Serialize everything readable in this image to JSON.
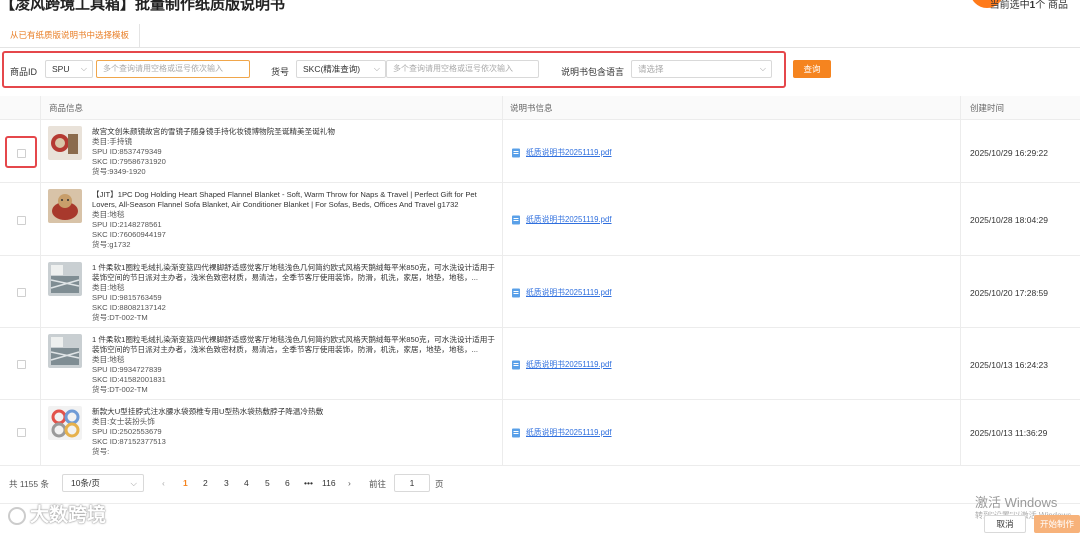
{
  "page": {
    "title": "【凌风跨境工具箱】批量制作纸质版说明书",
    "selected_prefix": "当前选中",
    "selected_count": "1",
    "selected_suffix": "个 商品"
  },
  "tabs": [
    {
      "label": "从已有纸质版说明书中选择模板"
    }
  ],
  "filters": {
    "product_id_label": "商品ID",
    "product_id_type": "SPU",
    "product_id_placeholder": "多个查询请用空格或逗号依次输入",
    "sku_label": "货号",
    "sku_type": "SKC(精准查询)",
    "sku_placeholder": "多个查询请用空格或逗号依次输入",
    "lang_label": "说明书包含语言",
    "lang_placeholder": "请选择",
    "query_button": "查询"
  },
  "table": {
    "columns": [
      "商品信息",
      "说明书信息",
      "创建时间"
    ],
    "rows": [
      {
        "title": "故宫文创朱颜镜故宫的雪镜子随身镜手持化妆镜博物院圣诞精美圣诞礼物",
        "category": "类目:手持镜",
        "spu": "SPU ID:8537479349",
        "skc": "SKC ID:79586731920",
        "sku": "货号:9349-1920",
        "pdf": "纸质说明书20251119.pdf",
        "created": "2025/10/29 16:29:22"
      },
      {
        "title": "【JIT】1PC Dog Holding Heart Shaped Flannel Blanket - Soft, Warm Throw for Naps & Travel | Perfect Gift for Pet Lovers, All-Season Flannel Sofa Blanket, Air Conditioner Blanket | For Sofas, Beds, Offices And Travel g1732",
        "category": "类目:地毯",
        "spu": "SPU ID:2148278561",
        "skc": "SKC ID:76060944197",
        "sku": "货号:g1732",
        "pdf": "纸质说明书20251119.pdf",
        "created": "2025/10/28 18:04:29"
      },
      {
        "title": "1 件柔软1圈粒毛绒扎染渐变篮四代裸脚舒适感觉客厅地毯浅色几何简约欧式风格天鹅绒每平米850克，可水洗设计适用于装饰空间的节日派对主办者，浅米色致密材质，易清洁，全季节客厅使用装饰，防滑，机洗，家居，地垫，地毯，...",
        "category": "类目:地毯",
        "spu": "SPU ID:9815763459",
        "skc": "SKC ID:88082137142",
        "sku": "货号:DT-002-TM",
        "pdf": "纸质说明书20251119.pdf",
        "created": "2025/10/20 17:28:59"
      },
      {
        "title": "1 件柔软1圈粒毛绒扎染渐变篮四代裸脚舒适感觉客厅地毯浅色几何简约欧式风格天鹅绒每平米850克，可水洗设计适用于装饰空间的节日派对主办者，浅米色致密材质，易清洁，全季节客厅使用装饰，防滑，机洗，家居，地垫，地毯，...",
        "category": "类目:地毯",
        "spu": "SPU ID:9934727839",
        "skc": "SKC ID:41582001831",
        "sku": "货号:DT-002-TM",
        "pdf": "纸质说明书20251119.pdf",
        "created": "2025/10/13 16:24:23"
      },
      {
        "title": "新款大U型挂脖式注水腰水袋颈椎专用U型热水袋热敷脖子降温冷热敷",
        "category": "类目:女士装扮头饰",
        "spu": "SPU ID:2502553679",
        "skc": "SKC ID:87152377513",
        "sku": "货号:",
        "pdf": "纸质说明书20251119.pdf",
        "created": "2025/10/13 11:36:29"
      }
    ]
  },
  "pagination": {
    "total": "共 1155 条",
    "page_size": "10条/页",
    "pages": [
      "1",
      "2",
      "3",
      "4",
      "5",
      "6",
      "•••",
      "116"
    ],
    "current": "1",
    "goto_label": "前往",
    "goto_value": "1",
    "page_suffix": "页"
  },
  "footer": {
    "logo_text": "大数跨境",
    "windows_title": "激活 Windows",
    "windows_sub": "转到\"设置\"以激活 Windows",
    "cancel_button": "取消",
    "start_button": "开始制作"
  },
  "colors": {
    "accent": "#f5841f",
    "highlight_box": "#e5474b",
    "link": "#2f6fde"
  }
}
